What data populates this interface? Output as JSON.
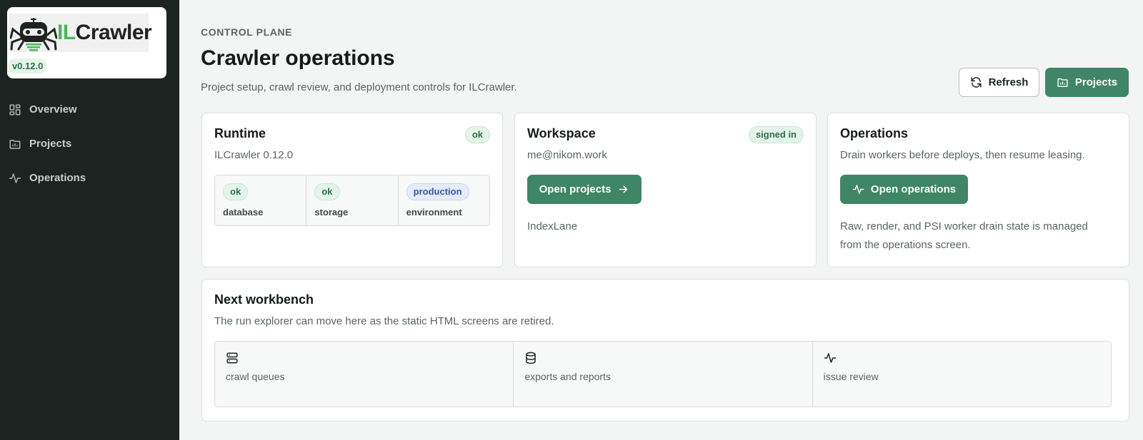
{
  "brand": {
    "logo_text_accent": "IL",
    "logo_text_rest": "Crawler",
    "version": "v0.12.0"
  },
  "sidebar": {
    "items": [
      {
        "label": "Overview",
        "icon": "grid-icon"
      },
      {
        "label": "Projects",
        "icon": "folder-icon"
      },
      {
        "label": "Operations",
        "icon": "activity-icon"
      }
    ]
  },
  "header": {
    "eyebrow": "CONTROL PLANE",
    "title": "Crawler operations",
    "subtitle": "Project setup, crawl review, and deployment controls for ILCrawler.",
    "refresh_label": "Refresh",
    "projects_label": "Projects"
  },
  "runtime": {
    "title": "Runtime",
    "status": "ok",
    "version_text": "ILCrawler 0.12.0",
    "stats": [
      {
        "value": "ok",
        "label": "database"
      },
      {
        "value": "ok",
        "label": "storage"
      },
      {
        "value": "production",
        "label": "environment"
      }
    ]
  },
  "workspace": {
    "title": "Workspace",
    "status": "signed in",
    "email": "me@nikom.work",
    "button_label": "Open projects",
    "org": "IndexLane"
  },
  "operations": {
    "title": "Operations",
    "description": "Drain workers before deploys, then resume leasing.",
    "button_label": "Open operations",
    "note_line1": "Raw, render, and PSI worker drain state is managed",
    "note_line2": "from the operations screen."
  },
  "workbench": {
    "title": "Next workbench",
    "description": "The run explorer can move here as the static HTML screens are retired.",
    "items": [
      {
        "label": "crawl queues",
        "icon": "server-icon"
      },
      {
        "label": "exports and reports",
        "icon": "database-icon"
      },
      {
        "label": "issue review",
        "icon": "activity-icon"
      }
    ]
  },
  "colors": {
    "sidebar_bg": "#1b2421",
    "accent_green": "#3f8567",
    "logo_green": "#4fb35d",
    "page_bg": "#f3f4f4"
  }
}
